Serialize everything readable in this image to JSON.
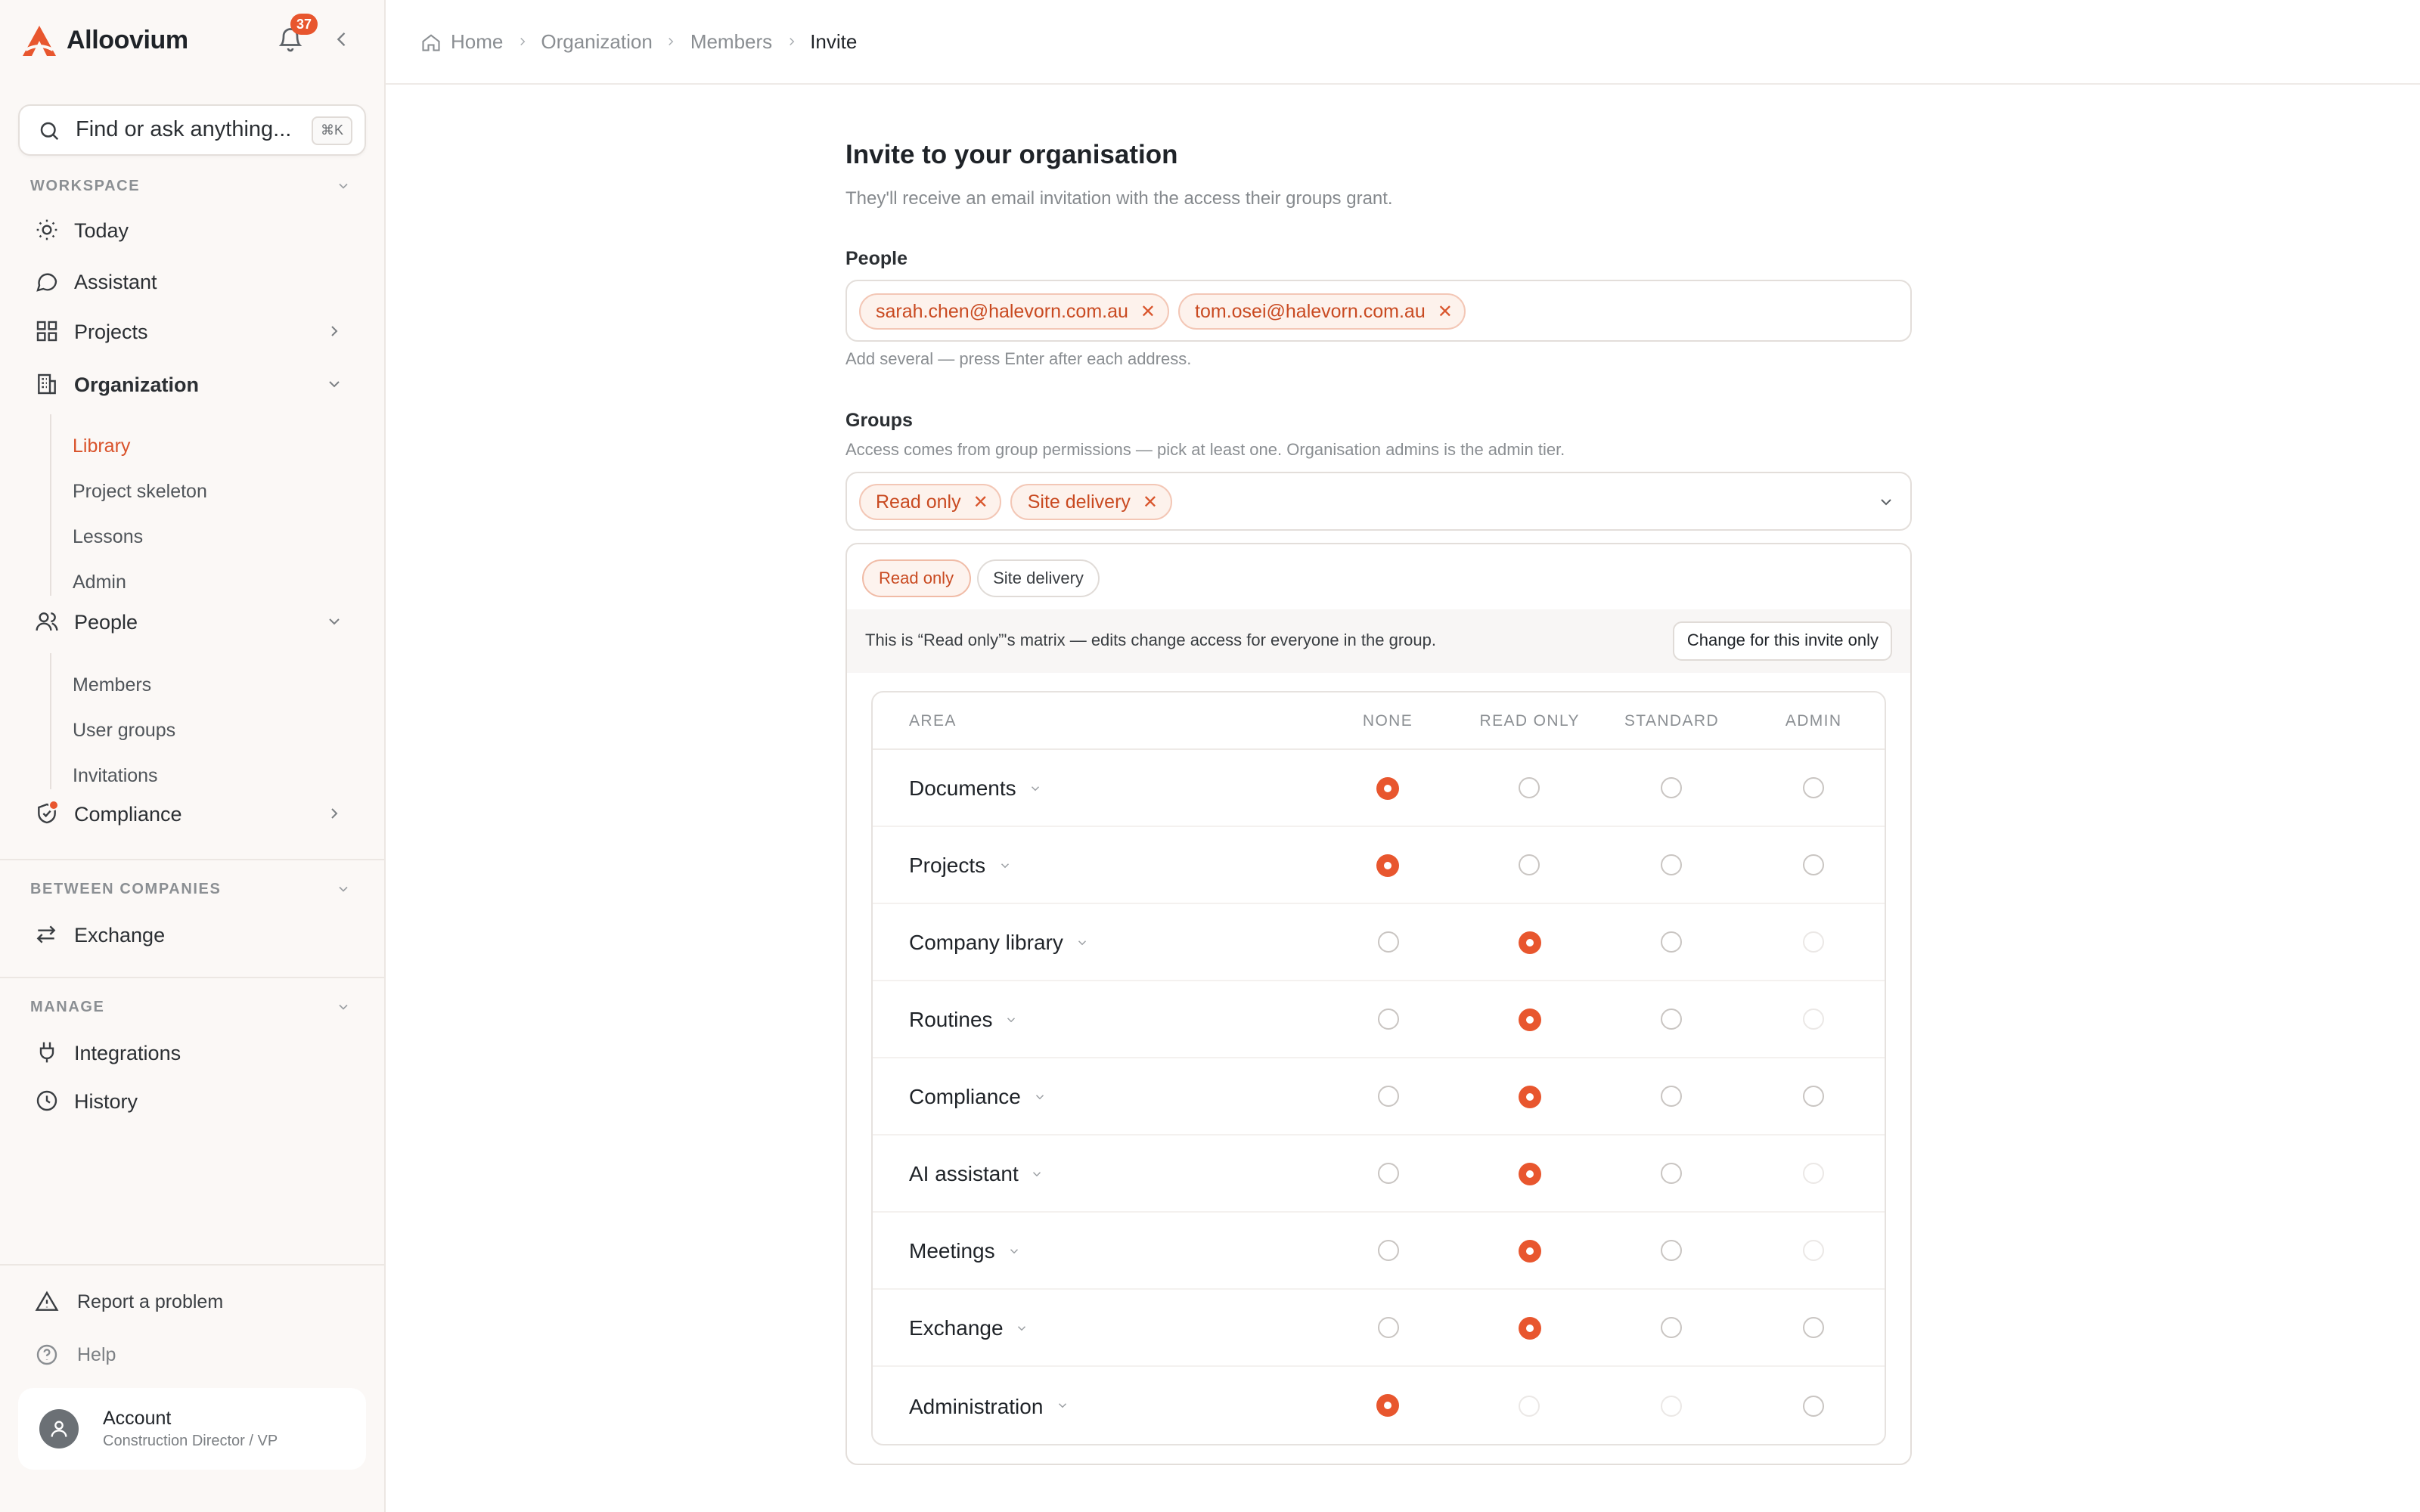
{
  "brand": {
    "name": "Alloovium",
    "color": "#e8562e"
  },
  "notifications": {
    "count": "37"
  },
  "search": {
    "placeholder": "Find or ask anything...",
    "shortcut": "⌘K"
  },
  "sidebar": {
    "workspace_label": "WORKSPACE",
    "items": {
      "today": "Today",
      "assistant": "Assistant",
      "projects": "Projects",
      "organization": "Organization",
      "people": "People",
      "compliance": "Compliance"
    },
    "org_sub": [
      "Library",
      "Project skeleton",
      "Lessons",
      "Admin"
    ],
    "people_sub": [
      "Members",
      "User groups",
      "Invitations"
    ],
    "between_label": "BETWEEN COMPANIES",
    "exchange": "Exchange",
    "manage_label": "MANAGE",
    "integrations": "Integrations",
    "history": "History",
    "report": "Report a problem",
    "help": "Help",
    "account_name": "Account",
    "account_role": "Construction Director / VP"
  },
  "breadcrumb": [
    "Home",
    "Organization",
    "Members",
    "Invite"
  ],
  "invite": {
    "title": "Invite to your organisation",
    "subtitle": "They'll receive an email invitation with the access their groups grant.",
    "people_label": "People",
    "people": [
      "sarah.chen@halevorn.com.au",
      "tom.osei@halevorn.com.au"
    ],
    "people_hint": "Add several — press Enter after each address.",
    "groups_label": "Groups",
    "groups_hint": "Access comes from group permissions — pick at least one. Organisation admins is the admin tier.",
    "groups": [
      "Read only",
      "Site delivery"
    ],
    "tabs": [
      "Read only",
      "Site delivery"
    ],
    "banner": "This is “Read only”'s matrix — edits change access for everyone in the group.",
    "change_button": "Change for this invite only"
  },
  "matrix": {
    "columns": [
      "AREA",
      "NONE",
      "READ ONLY",
      "STANDARD",
      "ADMIN"
    ],
    "rows": [
      {
        "area": "Documents",
        "selected": "none",
        "disabled": []
      },
      {
        "area": "Projects",
        "selected": "none",
        "disabled": []
      },
      {
        "area": "Company library",
        "selected": "read_only",
        "disabled": [
          "admin"
        ]
      },
      {
        "area": "Routines",
        "selected": "read_only",
        "disabled": [
          "admin"
        ]
      },
      {
        "area": "Compliance",
        "selected": "read_only",
        "disabled": []
      },
      {
        "area": "AI assistant",
        "selected": "read_only",
        "disabled": [
          "admin"
        ]
      },
      {
        "area": "Meetings",
        "selected": "read_only",
        "disabled": [
          "admin"
        ]
      },
      {
        "area": "Exchange",
        "selected": "read_only",
        "disabled": []
      },
      {
        "area": "Administration",
        "selected": "none",
        "disabled": [
          "read_only",
          "standard"
        ]
      }
    ]
  }
}
